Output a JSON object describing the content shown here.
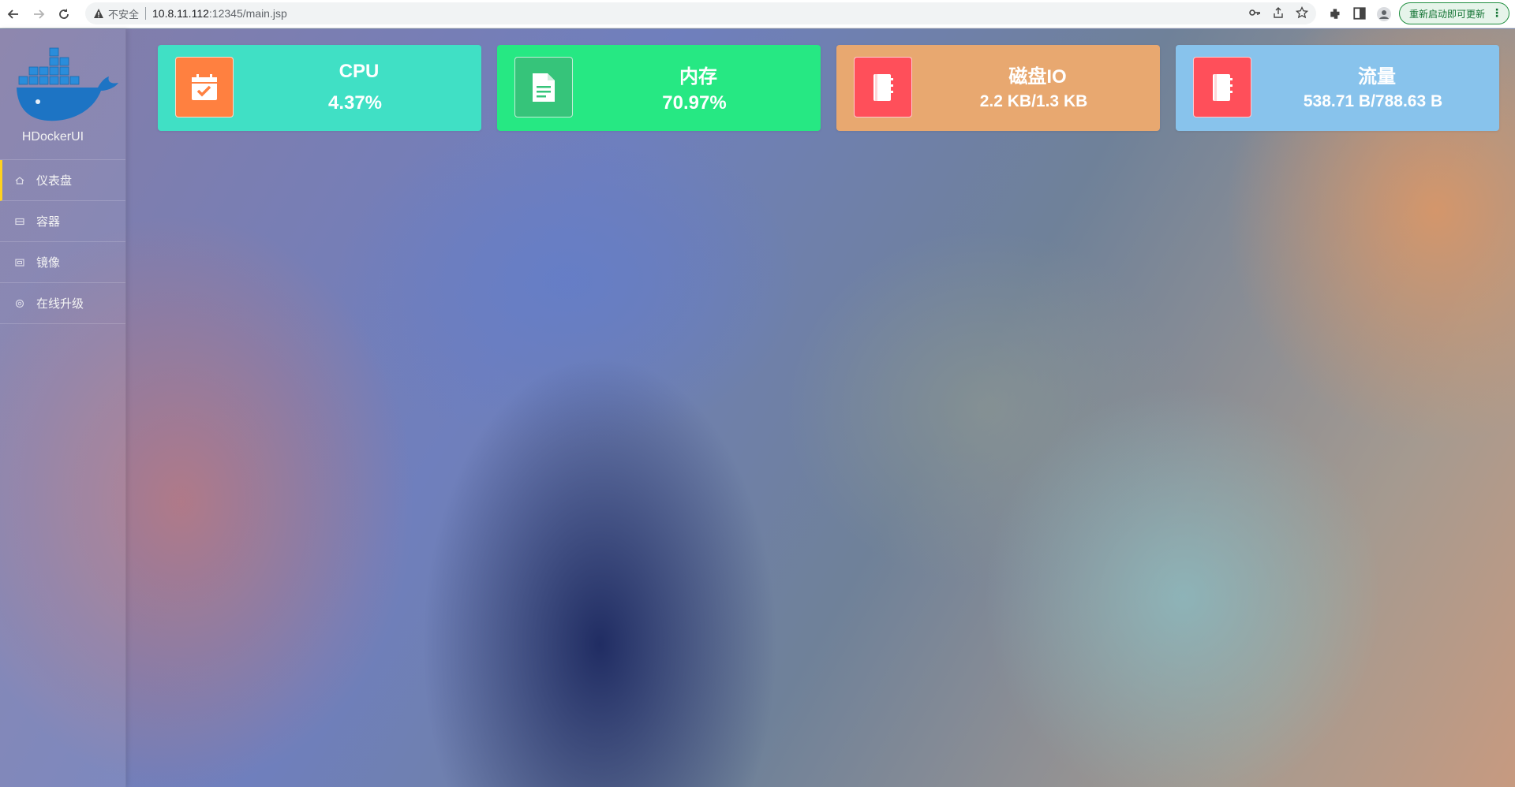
{
  "browser": {
    "insecure_label": "不安全",
    "url_host": "10.8.11.112",
    "url_path": ":12345/main.jsp",
    "update_button": "重新启动即可更新",
    "icons": [
      "back-icon",
      "forward-icon",
      "reload-icon",
      "key-icon",
      "share-icon",
      "star-icon",
      "extensions-icon",
      "sidepanel-icon",
      "profile-icon",
      "menu-icon"
    ]
  },
  "app": {
    "brand": "HDockerUI",
    "logo": "docker-whale-logo"
  },
  "sidebar": {
    "items": [
      {
        "label": "仪表盘",
        "icon": "home-icon",
        "active": true
      },
      {
        "label": "容器",
        "icon": "container-icon",
        "active": false
      },
      {
        "label": "镜像",
        "icon": "image-icon",
        "active": false
      },
      {
        "label": "在线升级",
        "icon": "upgrade-icon",
        "active": false
      }
    ]
  },
  "cards": [
    {
      "title": "CPU",
      "value": "4.37%",
      "color": "#40e0c5",
      "icon_bg": "#ff8040",
      "icon": "calendar-check-icon"
    },
    {
      "title": "内存",
      "value": "70.97%",
      "color": "#26e883",
      "icon_bg": "#36c47a",
      "icon": "document-icon"
    },
    {
      "title": "磁盘IO",
      "value": "2.2 KB/1.3 KB",
      "color": "#e8a870",
      "icon_bg": "#ff4f5a",
      "icon": "notebook-icon"
    },
    {
      "title": "流量",
      "value": "538.71 B/788.63 B",
      "color": "#88c3ec",
      "icon_bg": "#ff4f5a",
      "icon": "notebook-icon"
    }
  ]
}
